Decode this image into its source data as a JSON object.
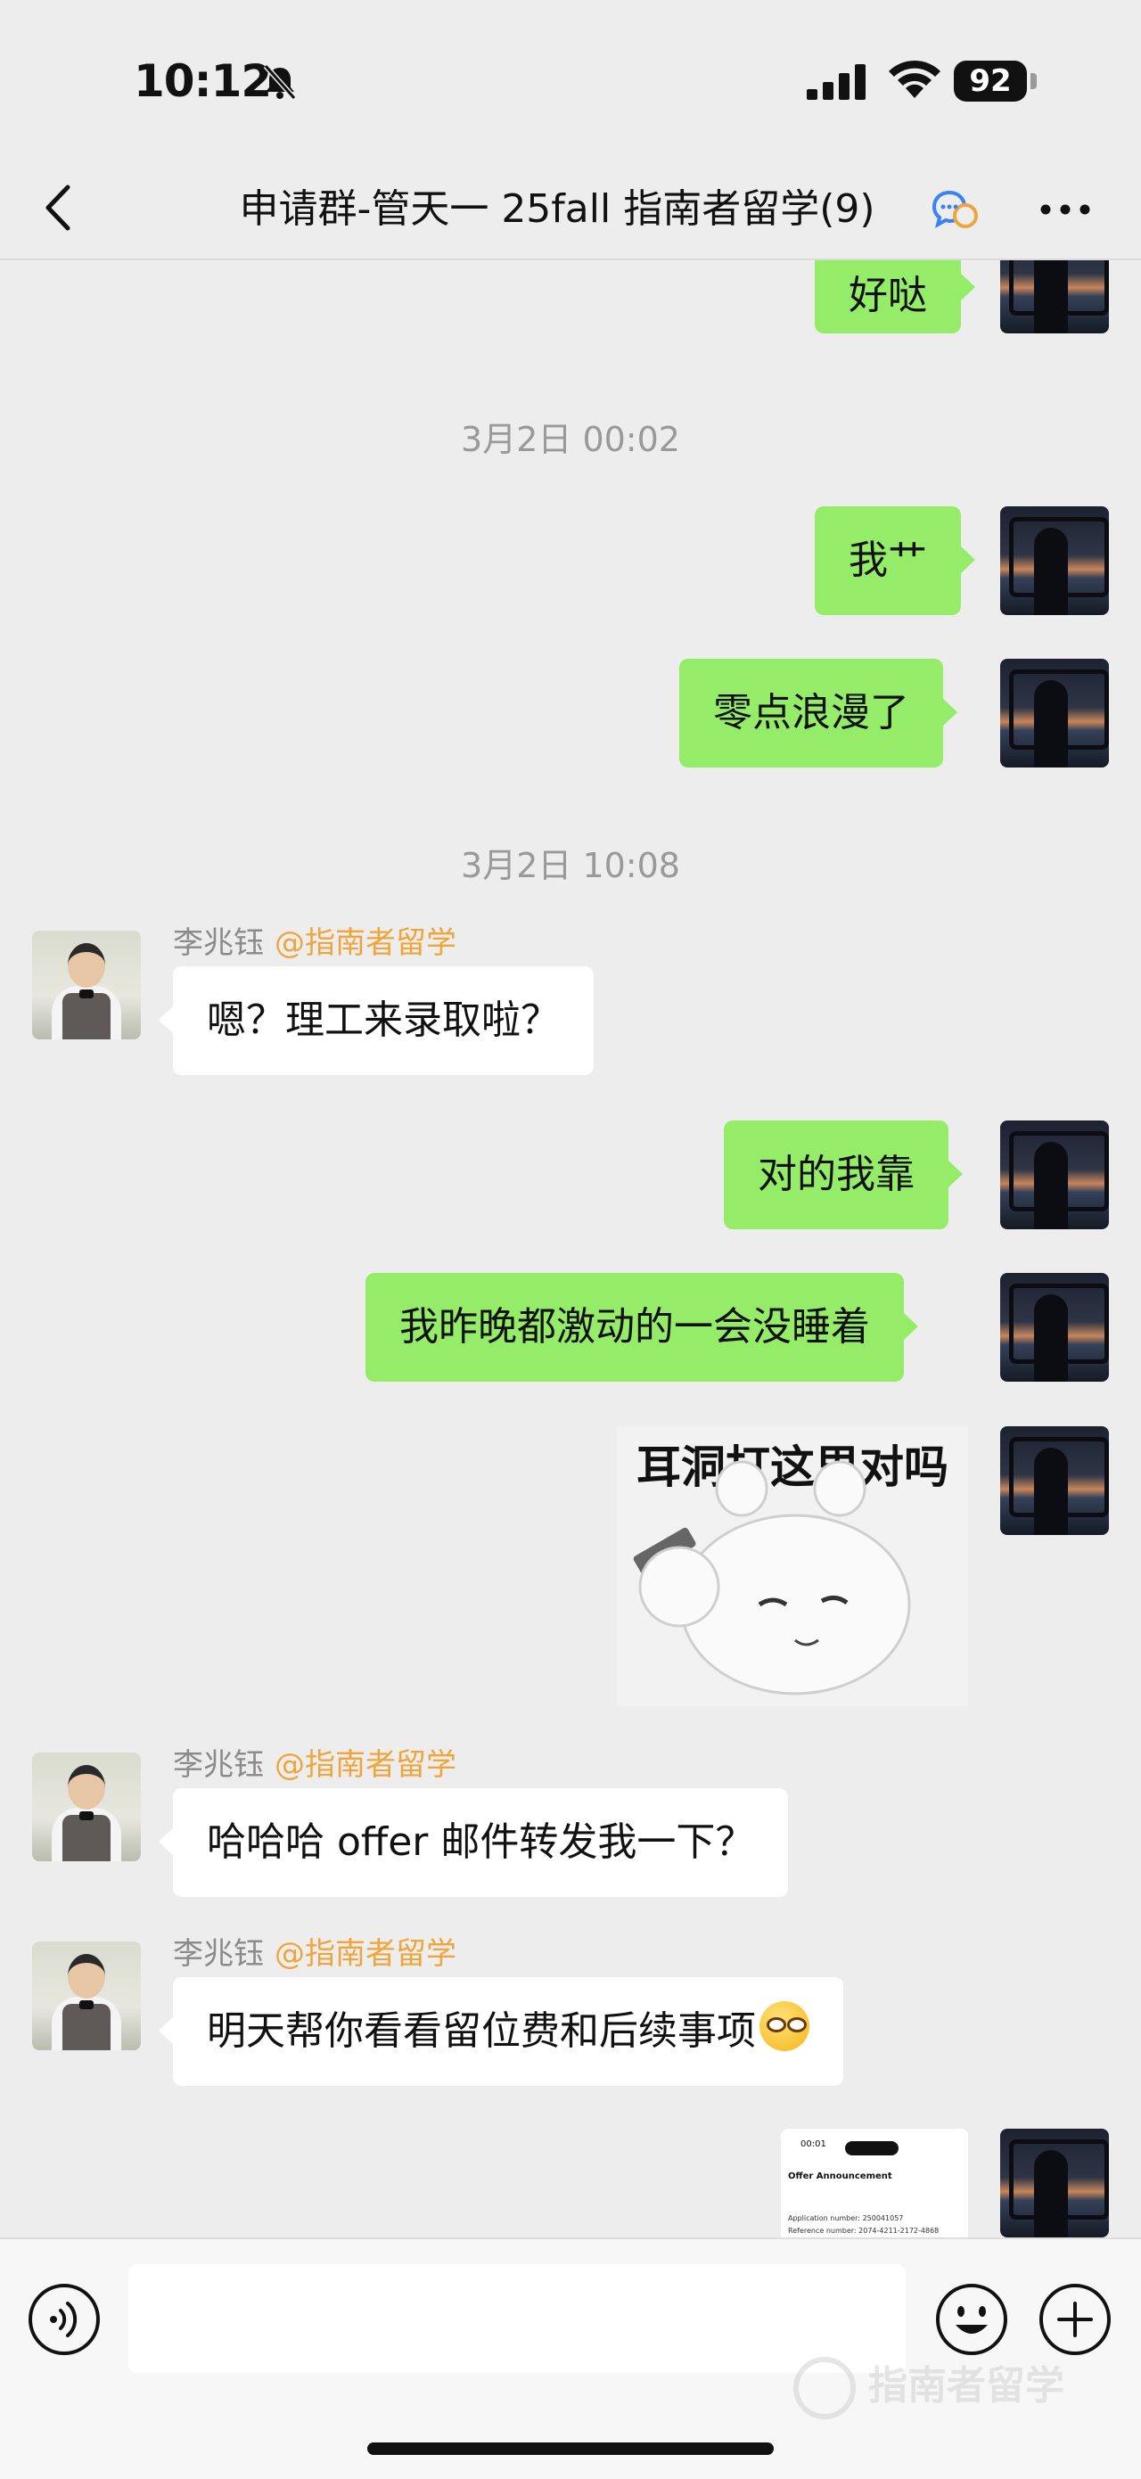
{
  "status_bar": {
    "time": "10:12",
    "battery": "92"
  },
  "header": {
    "title": "申请群-管天一 25fall 指南者留学(9)"
  },
  "messages": {
    "m0": "好哒",
    "ts1": "3月2日 00:02",
    "m1": "我艹",
    "m2": "零点浪漫了",
    "ts2": "3月2日 10:08",
    "sender_name": "李兆钰",
    "sender_org": "@指南者留学",
    "m3": "嗯？理工来录取啦？",
    "m4": "对的我靠",
    "m5": "我昨晚都激动的一会没睡着",
    "sticker_text": "耳洞打这里对吗",
    "m6": "哈哈哈 offer 邮件转发我一下？",
    "m7": "明天帮你看看留位费和后续事项",
    "thumb": {
      "time": "00:01",
      "title": "Offer Announcement",
      "line1": "Application number: 250041057",
      "line2": "Reference number: 2074-4211-2172-4868"
    }
  },
  "input_bar": {
    "placeholder": ""
  },
  "watermark": "指南者留学",
  "colors": {
    "self_bubble": "#95ec69",
    "other_bubble": "#ffffff",
    "sender_org": "#f0a53c",
    "background": "#ededed"
  },
  "icons": [
    "bell-off-icon",
    "signal-icon",
    "wifi-icon",
    "back-icon",
    "chat-bubbles-icon",
    "more-icon",
    "voice-icon",
    "emoji-icon",
    "plus-icon"
  ]
}
